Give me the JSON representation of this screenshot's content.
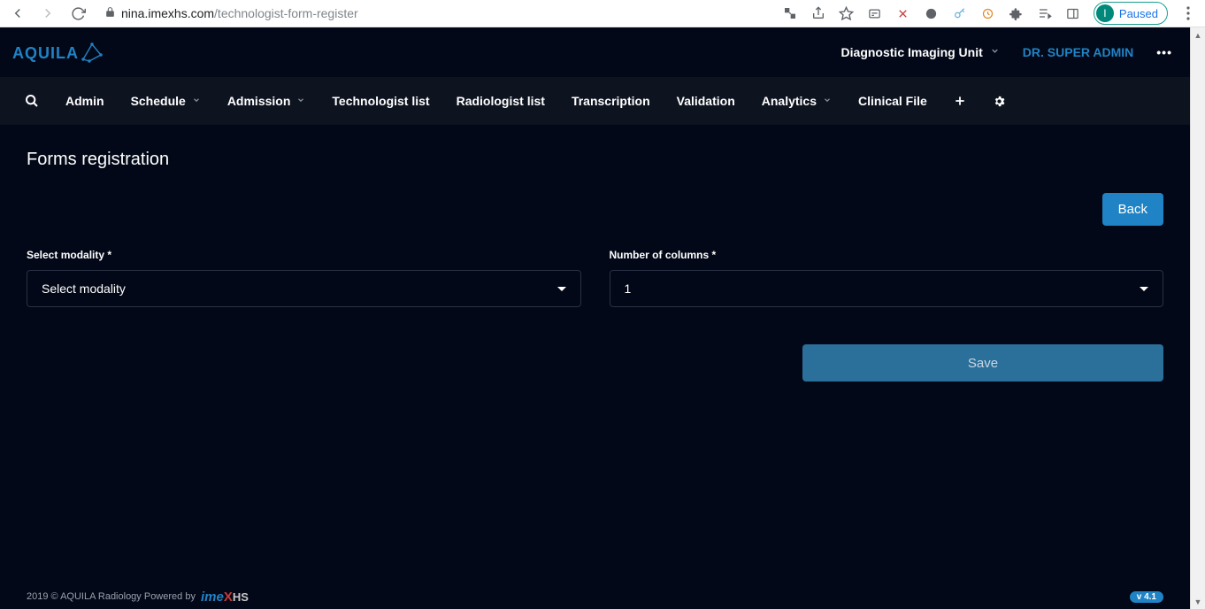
{
  "browser": {
    "url_domain": "nina.imexhs.com",
    "url_path": "/technologist-form-register",
    "profile_status": "Paused",
    "profile_initial": "I"
  },
  "header": {
    "logo_text": "AQUILA",
    "unit_label": "Diagnostic Imaging Unit",
    "user_name": "DR. SUPER ADMIN"
  },
  "nav": {
    "items": [
      {
        "label": "Admin",
        "has_sub": false
      },
      {
        "label": "Schedule",
        "has_sub": true
      },
      {
        "label": "Admission",
        "has_sub": true
      },
      {
        "label": "Technologist list",
        "has_sub": false
      },
      {
        "label": "Radiologist list",
        "has_sub": false
      },
      {
        "label": "Transcription",
        "has_sub": false
      },
      {
        "label": "Validation",
        "has_sub": false
      },
      {
        "label": "Analytics",
        "has_sub": true
      },
      {
        "label": "Clinical File",
        "has_sub": false
      }
    ]
  },
  "page": {
    "title": "Forms registration",
    "back_label": "Back",
    "save_label": "Save"
  },
  "form": {
    "modality": {
      "label": "Select modality *",
      "value": "Select modality"
    },
    "columns": {
      "label": "Number of columns *",
      "value": "1"
    }
  },
  "footer": {
    "copyright": "2019 © AQUILA Radiology Powered by",
    "brand_prefix": "ime",
    "brand_x": "X",
    "brand_suffix": "HS",
    "version": "v 4.1"
  }
}
